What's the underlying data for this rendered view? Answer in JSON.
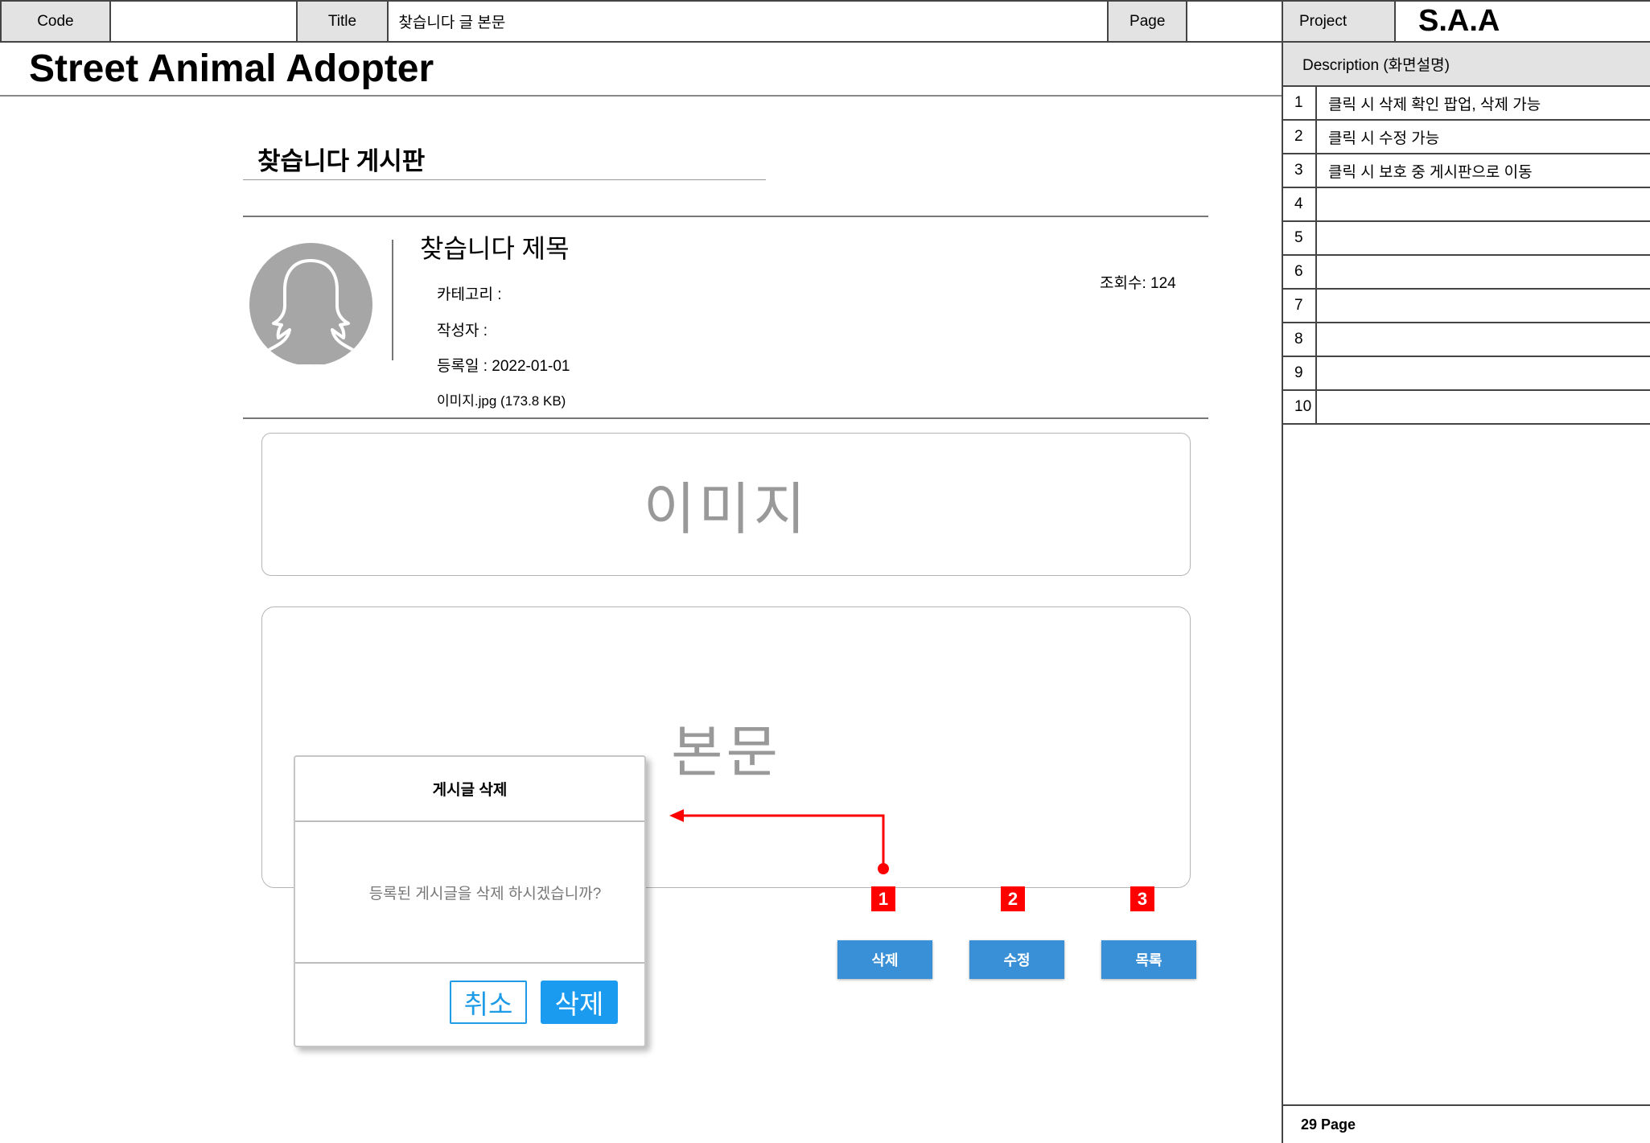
{
  "header": {
    "code_label": "Code",
    "code_value": "",
    "title_label": "Title",
    "title_value": "찾습니다 글 본문",
    "page_label": "Page",
    "page_value": "",
    "project_label": "Project",
    "project_value": "S.A.A"
  },
  "app_title": "Street Animal Adopter",
  "board_title": "찾습니다 게시판",
  "post": {
    "title": "찾습니다 제목",
    "category": "카테고리 :",
    "author": "작성자 :",
    "date": "등록일 : 2022-01-01",
    "attachment": "이미지.jpg (173.8 KB)",
    "views": "조회수: 124",
    "image_placeholder": "이미지",
    "body_placeholder": "본문"
  },
  "buttons": {
    "delete": "삭제",
    "edit": "수정",
    "list": "목록"
  },
  "markers": [
    "1",
    "2",
    "3"
  ],
  "dialog": {
    "title": "게시글 삭제",
    "message": "등록된 게시글을 삭제 하시겠습니까?",
    "cancel": "취소",
    "confirm": "삭제"
  },
  "description": {
    "header": "Description (화면설명)",
    "rows": [
      {
        "num": "1",
        "text": "클릭 시 삭제 확인 팝업, 삭제 가능"
      },
      {
        "num": "2",
        "text": "클릭 시 수정 가능"
      },
      {
        "num": "3",
        "text": "클릭 시 보호 중 게시판으로 이동"
      },
      {
        "num": "4",
        "text": ""
      },
      {
        "num": "5",
        "text": ""
      },
      {
        "num": "6",
        "text": ""
      },
      {
        "num": "7",
        "text": ""
      },
      {
        "num": "8",
        "text": ""
      },
      {
        "num": "9",
        "text": ""
      },
      {
        "num": "10",
        "text": ""
      }
    ]
  },
  "footer": "29 Page",
  "colors": {
    "button_blue": "#3a90d6",
    "dialog_blue": "#1a9bf0",
    "marker_red": "#ff0000",
    "placeholder_gray": "#999999"
  }
}
